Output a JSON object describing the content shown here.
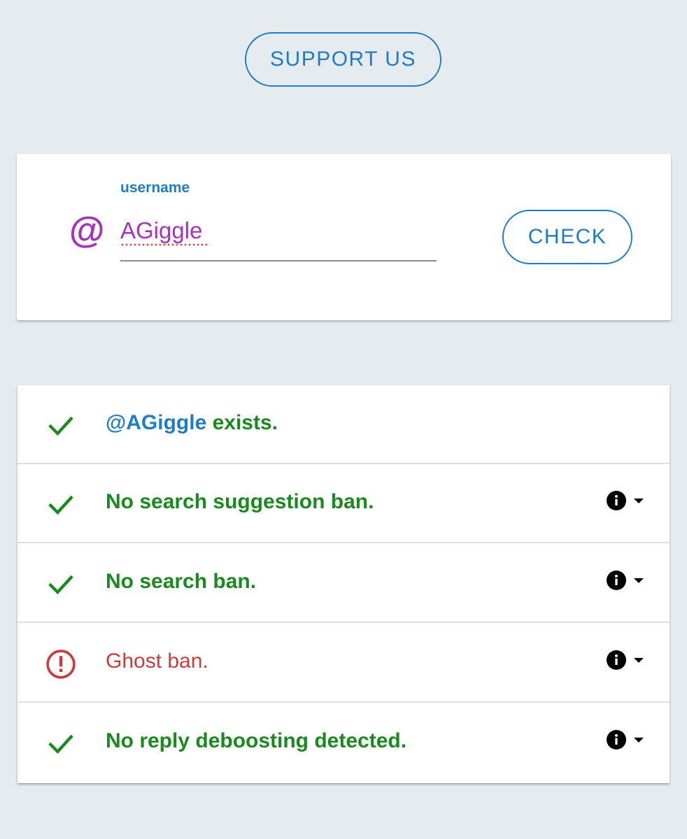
{
  "header": {
    "support_label": "SUPPORT US"
  },
  "search": {
    "label": "username",
    "value": "AGiggle",
    "check_label": "CHECK",
    "at_symbol": "@"
  },
  "results": [
    {
      "status": "ok",
      "icon": "check-icon",
      "username_text": "@AGiggle",
      "text": " exists.",
      "has_info": false
    },
    {
      "status": "ok",
      "icon": "check-icon",
      "text": "No search suggestion ban.",
      "has_info": true
    },
    {
      "status": "ok",
      "icon": "check-icon",
      "text": "No search ban.",
      "has_info": true
    },
    {
      "status": "ban",
      "icon": "alert-circle-icon",
      "text": "Ghost ban.",
      "has_info": true
    },
    {
      "status": "ok",
      "icon": "check-icon",
      "text": "No reply deboosting detected.",
      "has_info": true
    }
  ],
  "colors": {
    "accent_blue": "#1f7dc1",
    "ok_green": "#1a8a1f",
    "ban_red": "#c83c3c",
    "username_purple": "#a335b8",
    "background": "#e6ebef"
  }
}
